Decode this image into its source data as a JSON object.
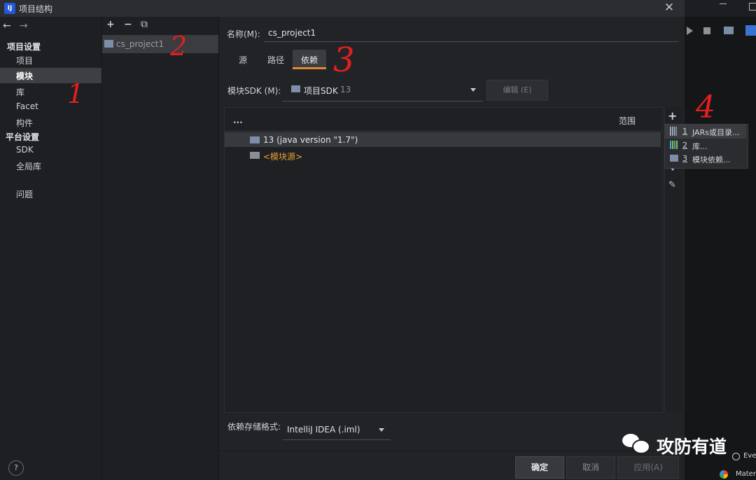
{
  "window": {
    "title": "项目结构",
    "close_glyph": "✕"
  },
  "nav": {
    "back": "←",
    "forward": "→",
    "project_settings_header": "项目设置",
    "project_items": [
      "项目",
      "模块",
      "库",
      "Facet",
      "构件"
    ],
    "platform_settings_header": "平台设置",
    "platform_items": [
      "SDK",
      "全局库"
    ],
    "problems": "问题"
  },
  "modules": {
    "toolbar": [
      "+",
      "−",
      "⧉"
    ],
    "item": "cs_project1"
  },
  "main": {
    "name_label": "名称(M):",
    "name_value": "cs_project1",
    "tabs": [
      "源",
      "路径",
      "依赖"
    ],
    "sdk_label": "模块SDK (M):",
    "sdk_value": "项目SDK",
    "sdk_version": "13",
    "edit_button": "编辑 (E)",
    "table_col1": "...",
    "table_scope": "范围",
    "dep_rows": [
      {
        "label": "13 (java version \"1.7\")"
      },
      {
        "label": "<模块源>"
      }
    ],
    "popup": [
      {
        "num": "1",
        "label": "JARs或目录..."
      },
      {
        "num": "2",
        "label": "库..."
      },
      {
        "num": "3",
        "label": "模块依赖..."
      }
    ],
    "storage_label": "依赖存储格式:",
    "storage_value": "IntelliJ IDEA (.iml)"
  },
  "footer": {
    "help": "?",
    "ok": "确定",
    "cancel": "取消",
    "apply": "应用(A)"
  },
  "annotations": [
    "1",
    "2",
    "3",
    "4"
  ],
  "watermark": {
    "text": "攻防有道"
  },
  "bg_app": {
    "text1": "Eve",
    "text2": "Mater"
  },
  "colors": {
    "accent_tab": "#e08a2b",
    "annotation": "#e0201e",
    "module_source": "#e6a033"
  }
}
